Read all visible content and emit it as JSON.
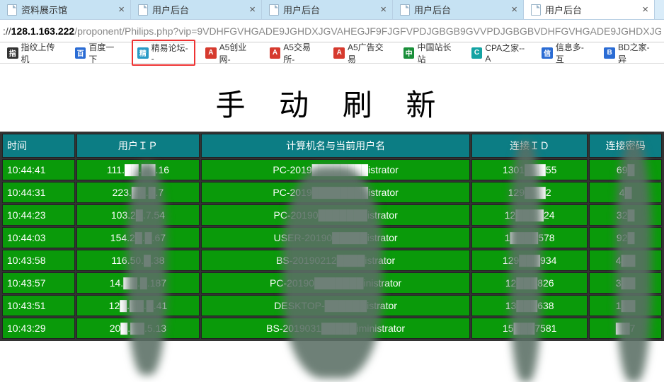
{
  "tabs": [
    {
      "label": "资料展示馆",
      "active": false
    },
    {
      "label": "用户后台",
      "active": false
    },
    {
      "label": "用户后台",
      "active": false
    },
    {
      "label": "用户后台",
      "active": false
    },
    {
      "label": "用户后台",
      "active": true
    }
  ],
  "url": {
    "prefix": "://",
    "host": "128.1.163.222",
    "rest": "/proponent/Philips.php?vip=9VDHFGVHGADE9JGHDXJGVAHEGJF9FJGFVPDJGBGB9GVVPDJGBGBVDHFGVHGADE9JGHDXJG"
  },
  "bookmarks": [
    {
      "label": "指纹上传机",
      "iconClass": "i-blk"
    },
    {
      "label": "百度一下",
      "iconClass": "i-b"
    },
    {
      "label": "精易论坛--",
      "iconClass": "i-cyan",
      "hl": true
    },
    {
      "label": "A5创业网-",
      "iconClass": "i-r"
    },
    {
      "label": "A5交易所-",
      "iconClass": "i-r"
    },
    {
      "label": "A5广告交易",
      "iconClass": "i-r"
    },
    {
      "label": "中国站长站",
      "iconClass": "i-g"
    },
    {
      "label": "CPA之家--A",
      "iconClass": "i-t"
    },
    {
      "label": "信息多-互",
      "iconClass": "i-b"
    },
    {
      "label": "BD之家-异",
      "iconClass": "i-b"
    }
  ],
  "heading": "手 动 刷 新",
  "columns": {
    "time": "时间",
    "ip": "用户ＩＰ",
    "host": "计算机名与当前用户名",
    "cid": "连接ＩＤ",
    "pwd": "连接密码"
  },
  "rows": [
    {
      "time": "10:44:41",
      "ip": "111.██.██.16",
      "host": "PC-2019████████istrator",
      "cid": "1301███55",
      "pwd": "69█"
    },
    {
      "time": "10:44:31",
      "ip": "223.██.█.7",
      "host": "PC-2019████████istrator",
      "cid": "129███2",
      "pwd": "4█"
    },
    {
      "time": "10:44:23",
      "ip": "103.2█.7.54",
      "host": "PC-20190███████istrator",
      "cid": "12████24",
      "pwd": "32█"
    },
    {
      "time": "10:44:03",
      "ip": "154.2█.█.67",
      "host": "USER-20190█████istrator",
      "cid": "1████578",
      "pwd": "92█"
    },
    {
      "time": "10:43:58",
      "ip": "116.50.█.38",
      "host": "BS-20190212████istrator",
      "cid": "129███934",
      "pwd": "4██"
    },
    {
      "time": "10:43:57",
      "ip": "14.██.█.187",
      "host": "PC-20190███████inistrator",
      "cid": "12███826",
      "pwd": "3██"
    },
    {
      "time": "10:43:51",
      "ip": "12█.██.█.41",
      "host": "DESKTOP-██████istrator",
      "cid": "13███638",
      "pwd": "1██"
    },
    {
      "time": "10:43:29",
      "ip": "20█.██.5.13",
      "host": "BS-2019031█████iministrator",
      "cid": "15███7581",
      "pwd": "██7"
    }
  ]
}
